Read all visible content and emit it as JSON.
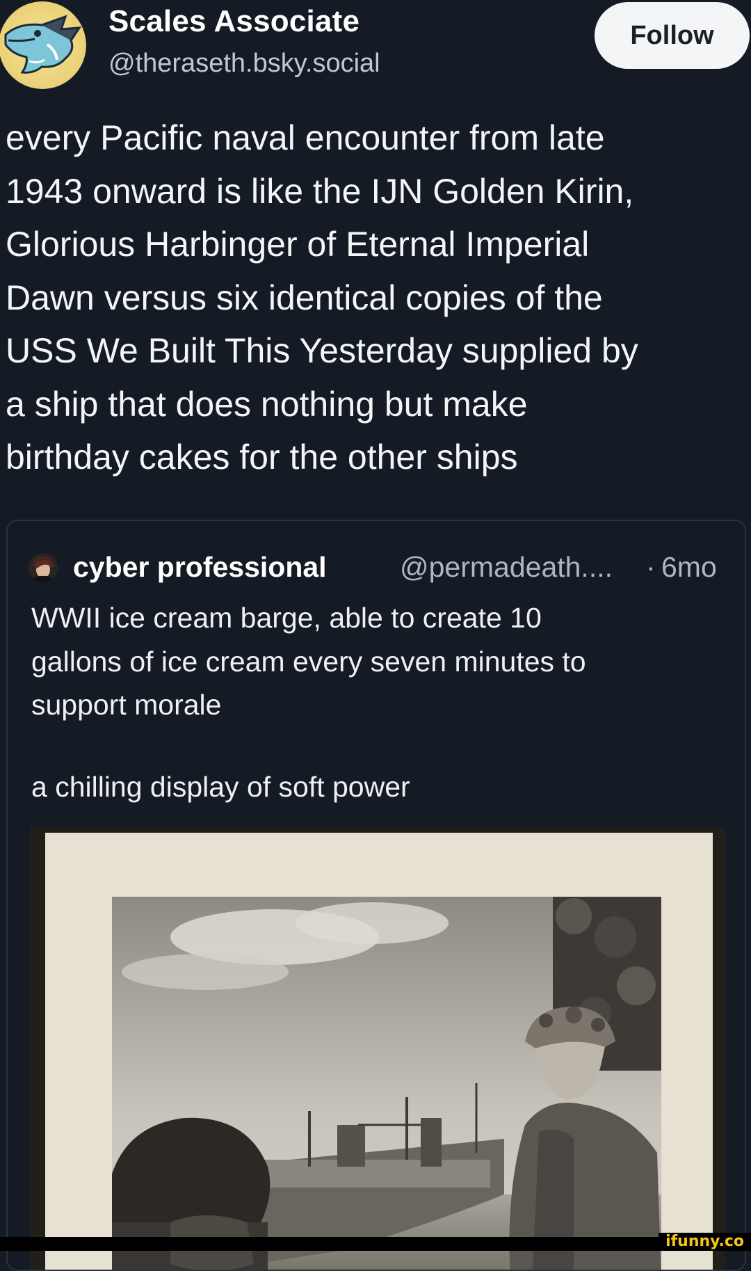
{
  "author": {
    "display_name": "Scales Associate",
    "handle": "@theraseth.bsky.social",
    "avatar_icon": "blue-dragon-avatar-icon"
  },
  "follow_button": {
    "label": "Follow"
  },
  "post": {
    "text": "every Pacific naval encounter from late\n1943 onward is like the IJN Golden Kirin,\nGlorious Harbinger of Eternal Imperial\nDawn versus six identical copies of the\nUSS We Built This Yesterday supplied by\na ship that does nothing but make\nbirthday cakes for the other ships"
  },
  "quoted_post": {
    "display_name": "cyber professional",
    "handle": "@permadeath....",
    "separator": "·",
    "time_ago": "6mo",
    "text_paragraph_1": "WWII ice cream barge, able to create 10\ngallons of ice cream every seven minutes to\nsupport morale",
    "text_paragraph_2": "a chilling display of soft power",
    "photo": {
      "subject": "black-and-white-photo-barge-soldiers"
    }
  },
  "watermark": {
    "text": "ifunny.co"
  },
  "colors": {
    "background": "#151b25",
    "text": "#f3f5f7",
    "muted": "#aeb6c0",
    "follow_bg": "#f4f5f7",
    "card_border": "#2b333f",
    "watermark": "#f5c518"
  }
}
